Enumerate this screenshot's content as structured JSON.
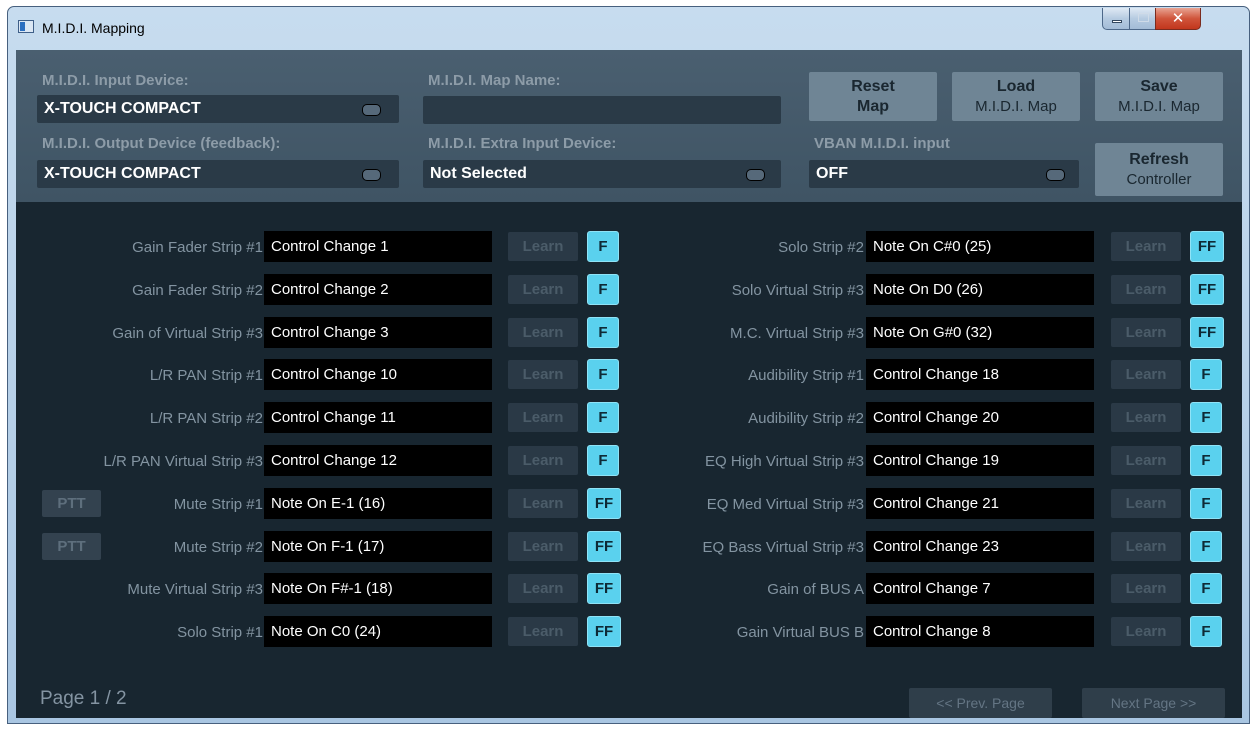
{
  "window": {
    "title": "M.I.D.I. Mapping"
  },
  "top": {
    "input_device": {
      "label": "M.I.D.I. Input Device:",
      "value": "X-TOUCH COMPACT"
    },
    "output_device": {
      "label": "M.I.D.I. Output Device (feedback):",
      "value": "X-TOUCH COMPACT"
    },
    "map_name": {
      "label": "M.I.D.I. Map Name:",
      "value": ""
    },
    "extra_input": {
      "label": "M.I.D.I. Extra Input Device:",
      "value": "Not Selected"
    },
    "vban_input": {
      "label": "VBAN M.I.D.I. input",
      "value": "OFF"
    },
    "buttons": {
      "reset": {
        "line1": "Reset",
        "line2": "Map"
      },
      "load": {
        "line1": "Load",
        "line2": "M.I.D.I. Map"
      },
      "save": {
        "line1": "Save",
        "line2": "M.I.D.I. Map"
      },
      "refresh": {
        "line1": "Refresh",
        "line2": "Controller"
      }
    }
  },
  "learn_label": "Learn",
  "ptt_label": "PTT",
  "rows_left": [
    {
      "label": "Gain Fader Strip #1",
      "value": "Control Change 1",
      "feedback": "F"
    },
    {
      "label": "Gain Fader Strip #2",
      "value": "Control Change 2",
      "feedback": "F"
    },
    {
      "label": "Gain of Virtual Strip #3",
      "value": "Control Change 3",
      "feedback": "F"
    },
    {
      "label": "L/R PAN Strip #1",
      "value": "Control Change 10",
      "feedback": "F"
    },
    {
      "label": "L/R PAN Strip #2",
      "value": "Control Change 11",
      "feedback": "F"
    },
    {
      "label": "L/R PAN Virtual Strip #3",
      "value": "Control Change 12",
      "feedback": "F"
    },
    {
      "label": "Mute Strip #1",
      "value": "Note On E-1 (16)",
      "feedback": "FF"
    },
    {
      "label": "Mute Strip #2",
      "value": "Note On F-1 (17)",
      "feedback": "FF"
    },
    {
      "label": "Mute Virtual Strip #3",
      "value": "Note On F#-1 (18)",
      "feedback": "FF"
    },
    {
      "label": "Solo Strip #1",
      "value": "Note On C0 (24)",
      "feedback": "FF"
    }
  ],
  "rows_right": [
    {
      "label": "Solo Strip #2",
      "value": "Note On C#0 (25)",
      "feedback": "FF"
    },
    {
      "label": "Solo Virtual Strip #3",
      "value": "Note On D0 (26)",
      "feedback": "FF"
    },
    {
      "label": "M.C. Virtual Strip #3",
      "value": "Note On G#0 (32)",
      "feedback": "FF"
    },
    {
      "label": "Audibility Strip #1",
      "value": "Control Change 18",
      "feedback": "F"
    },
    {
      "label": "Audibility Strip #2",
      "value": "Control Change 20",
      "feedback": "F"
    },
    {
      "label": "EQ High Virtual Strip #3",
      "value": "Control Change 19",
      "feedback": "F"
    },
    {
      "label": "EQ Med Virtual Strip #3",
      "value": "Control Change 21",
      "feedback": "F"
    },
    {
      "label": "EQ Bass Virtual Strip #3",
      "value": "Control Change 23",
      "feedback": "F"
    },
    {
      "label": "Gain of BUS A",
      "value": "Control Change 7",
      "feedback": "F"
    },
    {
      "label": "Gain Virtual BUS B",
      "value": "Control Change 8",
      "feedback": "F"
    }
  ],
  "footer": {
    "page": "Page 1 / 2",
    "prev": "<< Prev. Page",
    "next": "Next Page >>"
  }
}
